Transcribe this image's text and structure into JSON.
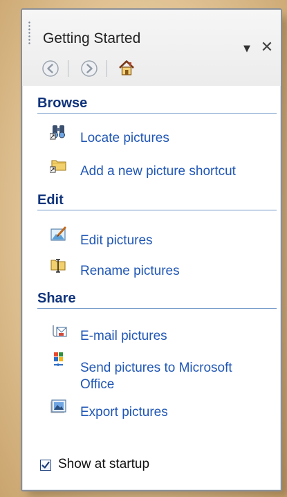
{
  "pane": {
    "title": "Getting Started",
    "dropdown_glyph": "▼",
    "close_glyph": "✕"
  },
  "toolbar": {
    "back_icon": "back-arrow-icon",
    "forward_icon": "forward-arrow-icon",
    "home_icon": "home-icon"
  },
  "sections": {
    "browse": {
      "heading": "Browse",
      "items": [
        {
          "label": "Locate pictures",
          "icon": "binoculars-icon"
        },
        {
          "label": "Add a new picture shortcut",
          "icon": "folder-shortcut-icon"
        }
      ]
    },
    "edit": {
      "heading": "Edit",
      "items": [
        {
          "label": "Edit pictures",
          "icon": "paintbrush-picture-icon"
        },
        {
          "label": "Rename pictures",
          "icon": "rename-folder-icon"
        }
      ]
    },
    "share": {
      "heading": "Share",
      "items": [
        {
          "label": "E-mail pictures",
          "icon": "email-attachment-icon"
        },
        {
          "label": "Send pictures to Microsoft",
          "label_line2": "Office",
          "icon": "office-icon"
        },
        {
          "label": "Export pictures",
          "icon": "export-pictures-icon"
        }
      ]
    }
  },
  "footer": {
    "show_at_startup_label": "Show at startup",
    "show_at_startup_checked": true
  },
  "colors": {
    "link": "#1f56b5",
    "heading": "#10347c",
    "heading_rule": "#6f96c7"
  }
}
